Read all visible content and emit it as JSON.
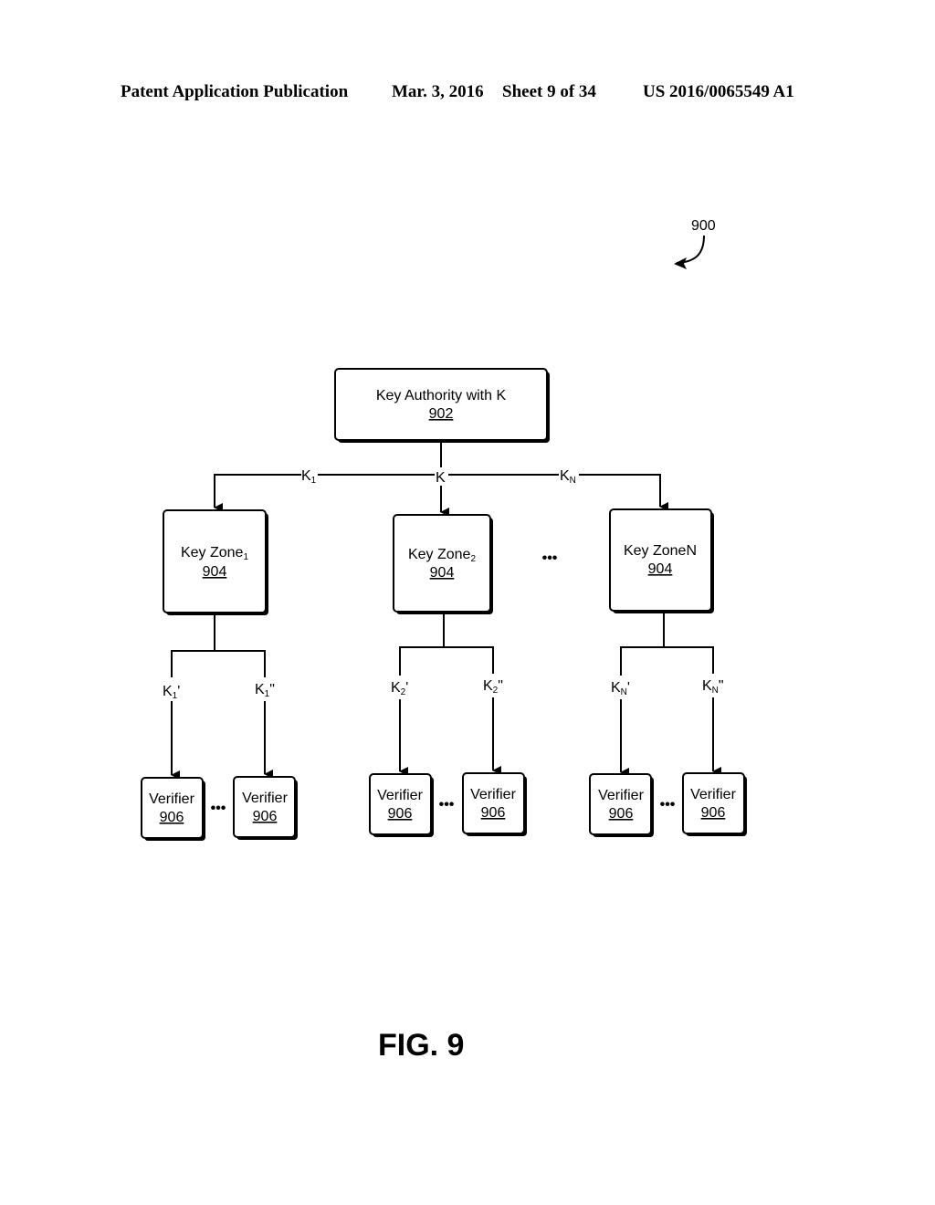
{
  "header": {
    "publication": "Patent Application Publication",
    "date": "Mar. 3, 2016",
    "sheet": "Sheet 9 of 34",
    "number": "US 2016/0065549 A1"
  },
  "figure_ref": "900",
  "figure_caption": "FIG. 9",
  "key_authority": {
    "label": "Key Authority with K",
    "ref": "902"
  },
  "trunk_labels": {
    "left": "K",
    "left_sub": "1",
    "center": "K",
    "right": "K",
    "right_sub": "N"
  },
  "zones": [
    {
      "label": "Key Zone",
      "sub": "1",
      "ref": "904",
      "branches": [
        {
          "k": "K",
          "sub": "1",
          "prime": "'"
        },
        {
          "k": "K",
          "sub": "1",
          "prime": "\""
        }
      ]
    },
    {
      "label": "Key Zone",
      "sub": "2",
      "ref": "904",
      "branches": [
        {
          "k": "K",
          "sub": "2",
          "prime": "'"
        },
        {
          "k": "K",
          "sub": "2",
          "prime": "\""
        }
      ]
    },
    {
      "label": "Key ZoneN",
      "sub": "",
      "ref": "904",
      "branches": [
        {
          "k": "K",
          "sub": "N",
          "prime": "'"
        },
        {
          "k": "K",
          "sub": "N",
          "prime": "\""
        }
      ]
    }
  ],
  "verifier": {
    "label": "Verifier",
    "ref": "906"
  },
  "ellipsis": "•••"
}
